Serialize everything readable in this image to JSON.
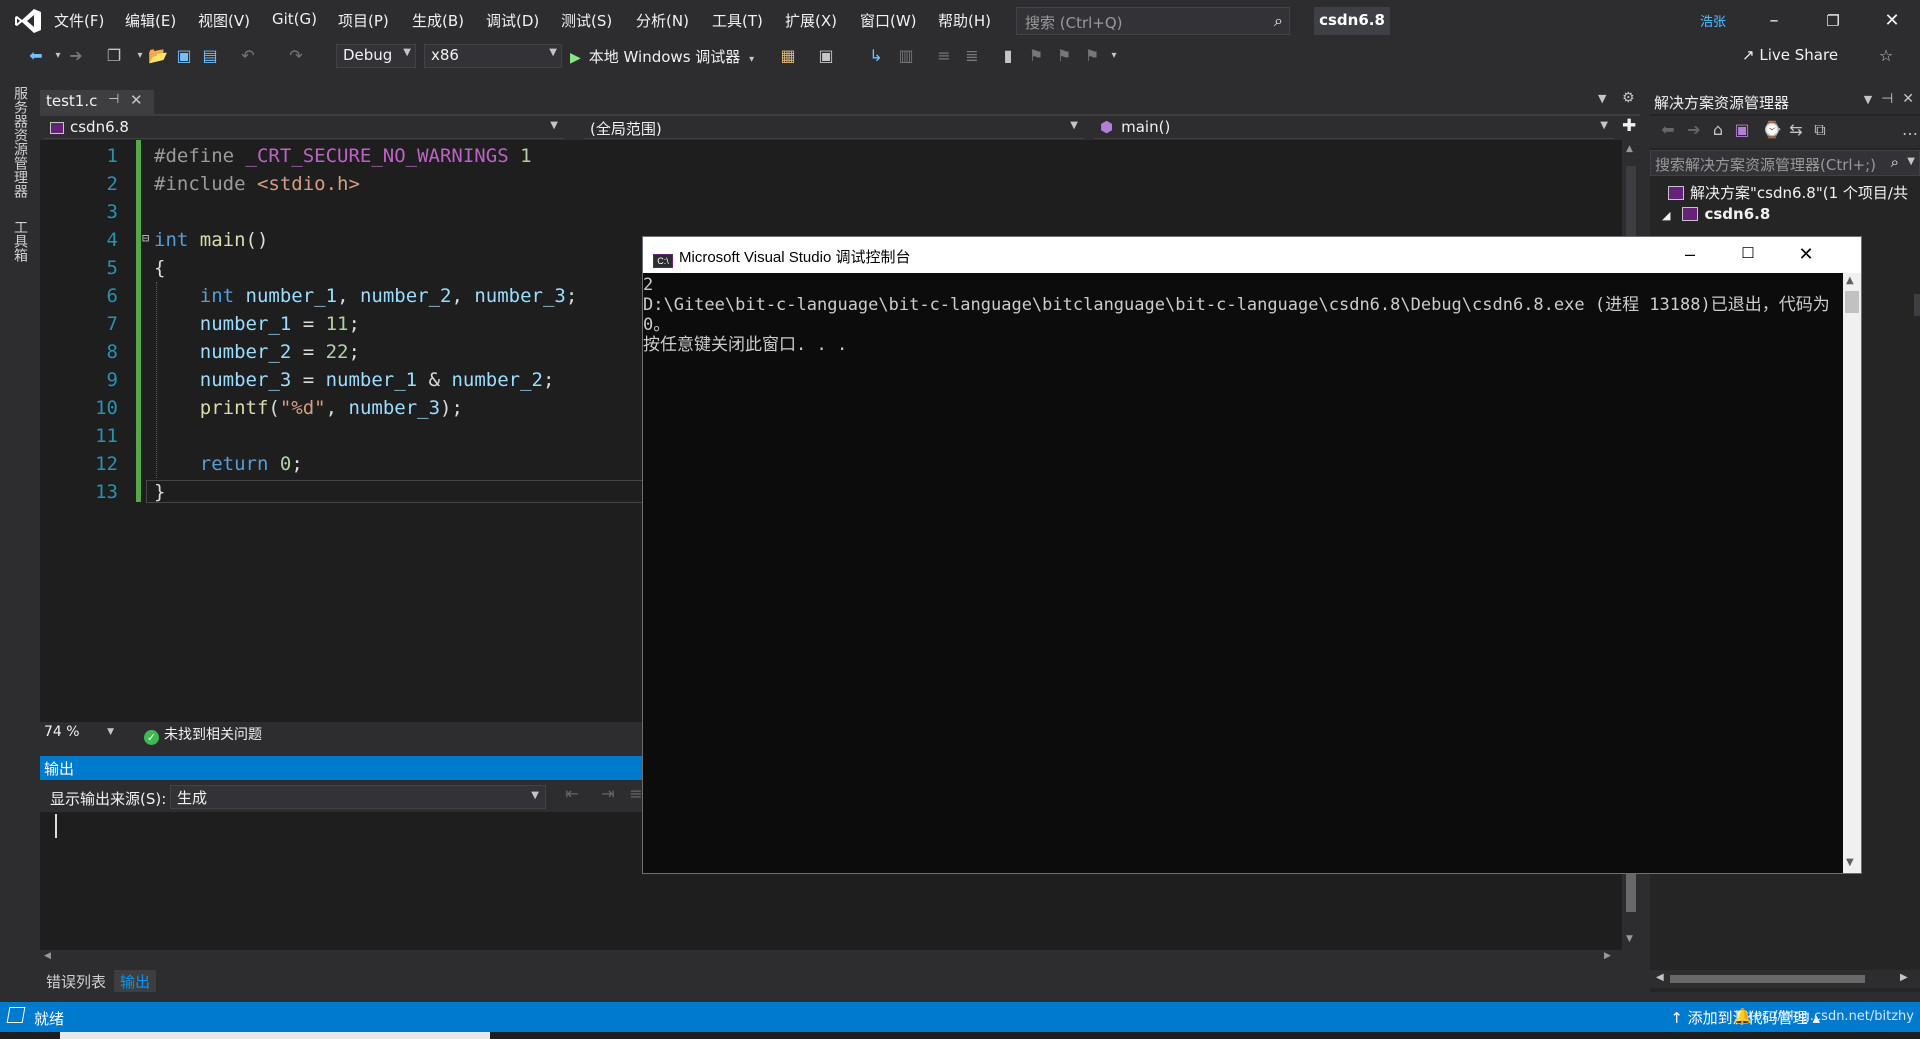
{
  "menu": {
    "items": [
      "文件(F)",
      "编辑(E)",
      "视图(V)",
      "Git(G)",
      "项目(P)",
      "生成(B)",
      "调试(D)",
      "测试(S)",
      "分析(N)",
      "工具(T)",
      "扩展(X)",
      "窗口(W)",
      "帮助(H)"
    ]
  },
  "search": {
    "placeholder": "搜索 (Ctrl+Q)"
  },
  "solution_name": "csdn6.8",
  "user_avatar": "浩张",
  "toolbar": {
    "config": "Debug",
    "platform": "x86",
    "run_label": "本地 Windows 调试器",
    "live_share": "Live Share"
  },
  "side_tabs": [
    "服务器资源管理器",
    "工具箱"
  ],
  "editor": {
    "tab_name": "test1.c",
    "nav_project": "csdn6.8",
    "nav_scope": "(全局范围)",
    "nav_member": "main()",
    "line_numbers": [
      "1",
      "2",
      "3",
      "4",
      "5",
      "6",
      "7",
      "8",
      "9",
      "10",
      "11",
      "12",
      "13"
    ],
    "zoom": "74 %",
    "issues": "未找到相关问题"
  },
  "output": {
    "title": "输出",
    "source_label": "显示输出来源(S):",
    "source_value": "生成"
  },
  "bottom_tabs": [
    "错误列表",
    "输出"
  ],
  "solution_explorer": {
    "title": "解决方案资源管理器",
    "search_placeholder": "搜索解决方案资源管理器(Ctrl+;)",
    "solution_item": "解决方案\"csdn6.8\"(1 个项目/共",
    "project_item": "csdn6.8"
  },
  "status": {
    "text": "就绪",
    "source_control": "添加到源代码管理",
    "watermark": "https://blog.csdn.net/bitzhy"
  },
  "console": {
    "title": "Microsoft Visual Studio 调试控制台",
    "lines": [
      "2",
      "D:\\Gitee\\bit-c-language\\bit-c-language\\bitclanguage\\bit-c-language\\csdn6.8\\Debug\\csdn6.8.exe (进程 13188)已退出，代码为",
      "0。",
      "按任意键关闭此窗口. . ."
    ]
  },
  "colors": {
    "accent": "#007acc",
    "editor_bg": "#1e1e1e",
    "keyword": "#569cd6",
    "line_number": "#2b91af"
  }
}
